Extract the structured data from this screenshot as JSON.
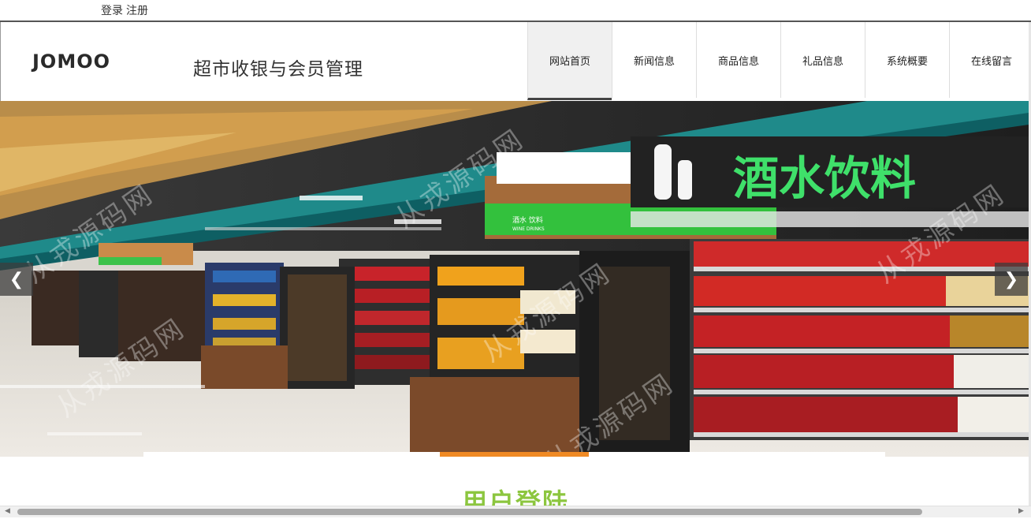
{
  "topbar": {
    "login_label": "登录",
    "register_label": "注册"
  },
  "header": {
    "logo_text": "JOMOO",
    "site_title": "超市收银与会员管理"
  },
  "nav": {
    "items": [
      {
        "label": "网站首页",
        "active": true
      },
      {
        "label": "新闻信息",
        "active": false
      },
      {
        "label": "商品信息",
        "active": false
      },
      {
        "label": "礼品信息",
        "active": false
      },
      {
        "label": "系统概要",
        "active": false
      },
      {
        "label": "在线留言",
        "active": false
      }
    ]
  },
  "banner": {
    "sign_text": "酒水饮料",
    "sub_sign_text": "酒水 饮料",
    "sub_sign_en": "WINE DRINKS",
    "prev_icon": "chevron-left-icon",
    "next_icon": "chevron-right-icon",
    "slide_count": 5,
    "active_slide": 2,
    "accent_color": "#f08a24"
  },
  "section": {
    "title": "用户登陆"
  },
  "watermark": "从戎源码网",
  "colors": {
    "title_green": "#8cc63f",
    "indicator_orange": "#f08a24"
  }
}
